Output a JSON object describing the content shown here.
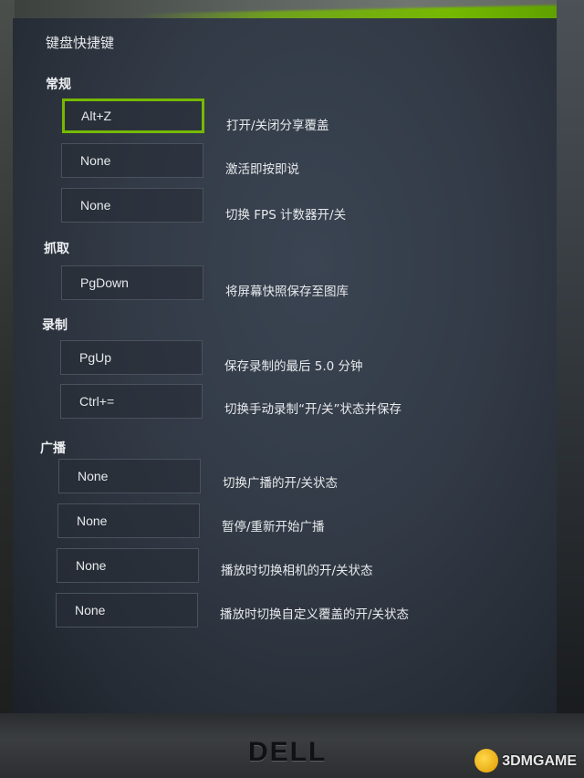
{
  "panel_title": "键盘快捷键",
  "sections": {
    "general": "常规",
    "capture": "抓取",
    "record": "录制",
    "broadcast": "广播"
  },
  "shortcuts": [
    {
      "key": "Alt+Z",
      "desc": "打开/关闭分享覆盖",
      "active": true
    },
    {
      "key": "None",
      "desc": "激活即按即说"
    },
    {
      "key": "None",
      "desc": "切换 FPS 计数器开/关"
    },
    {
      "key": "PgDown",
      "desc": "将屏幕快照保存至图库"
    },
    {
      "key": "PgUp",
      "desc": "保存录制的最后 5.0 分钟"
    },
    {
      "key": "Ctrl+=",
      "desc": "切换手动录制“开/关”状态并保存"
    },
    {
      "key": "None",
      "desc": "切换广播的开/关状态"
    },
    {
      "key": "None",
      "desc": "暂停/重新开始广播"
    },
    {
      "key": "None",
      "desc": "播放时切换相机的开/关状态"
    },
    {
      "key": "None",
      "desc": "播放时切换自定义覆盖的开/关状态"
    }
  ],
  "monitor_brand": "DELL",
  "watermark": "3DMGAME",
  "colors": {
    "accent": "#76b900",
    "panel_bg": "#323a46",
    "text": "#e8eaec"
  }
}
